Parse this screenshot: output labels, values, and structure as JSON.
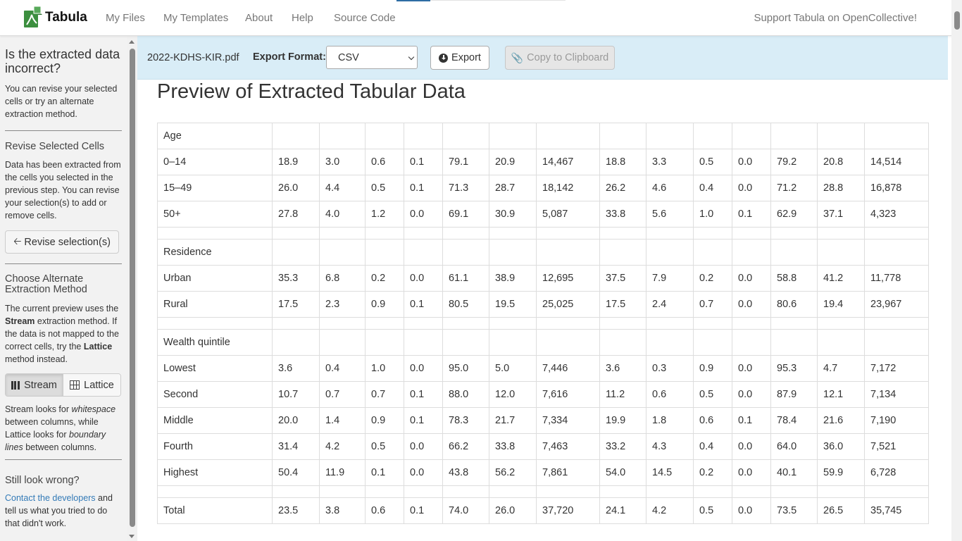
{
  "navbar": {
    "brand": "Tabula",
    "links": [
      "My Files",
      "My Templates",
      "About",
      "Help",
      "Source Code"
    ],
    "support": "Support Tabula on OpenCollective!"
  },
  "sidebar": {
    "heading": "Is the extracted data incorrect?",
    "intro": "You can revise your selected cells or try an alternate extraction method.",
    "revise_heading": "Revise Selected Cells",
    "revise_text": "Data has been extracted from the cells you selected in the previous step. You can revise your selection(s) to add or remove cells.",
    "revise_button": "Revise selection(s)",
    "method_heading": "Choose Alternate Extraction Method",
    "method_text_1": "The current preview uses the",
    "method_current": "Stream",
    "method_text_2": "extraction method. If the data is not mapped to the correct cells, try the",
    "method_alt": "Lattice",
    "method_text_3": "method instead.",
    "stream_button": "Stream",
    "lattice_button": "Lattice",
    "explain_1": "Stream looks for",
    "explain_whitespace": "whitespace",
    "explain_2": "between columns, while Lattice looks for",
    "explain_boundary": "boundary lines",
    "explain_3": "between columns.",
    "wrong_heading": "Still look wrong?",
    "contact_link": "Contact the developers",
    "contact_text": "and tell us what you tried to do that didn't work."
  },
  "toolbar": {
    "filename": "2022-KDHS-KIR.pdf",
    "export_format_label": "Export Format:",
    "export_format_value": "CSV",
    "export_button": "Export",
    "copy_button": "Copy to Clipboard"
  },
  "preview": {
    "title": "Preview of Extracted Tabular Data"
  },
  "table": {
    "rows": [
      [
        "Age",
        "",
        "",
        "",
        "",
        "",
        "",
        "",
        "",
        "",
        "",
        "",
        "",
        "",
        ""
      ],
      [
        "0–14",
        "18.9",
        "3.0",
        "0.6",
        "0.1",
        "79.1",
        "20.9",
        "14,467",
        "18.8",
        "3.3",
        "0.5",
        "0.0",
        "79.2",
        "20.8",
        "14,514"
      ],
      [
        "15–49",
        "26.0",
        "4.4",
        "0.5",
        "0.1",
        "71.3",
        "28.7",
        "18,142",
        "26.2",
        "4.6",
        "0.4",
        "0.0",
        "71.2",
        "28.8",
        "16,878"
      ],
      [
        "50+",
        "27.8",
        "4.0",
        "1.2",
        "0.0",
        "69.1",
        "30.9",
        "5,087",
        "33.8",
        "5.6",
        "1.0",
        "0.1",
        "62.9",
        "37.1",
        "4,323"
      ],
      [],
      [
        "Residence",
        "",
        "",
        "",
        "",
        "",
        "",
        "",
        "",
        "",
        "",
        "",
        "",
        "",
        ""
      ],
      [
        "Urban",
        "35.3",
        "6.8",
        "0.2",
        "0.0",
        "61.1",
        "38.9",
        "12,695",
        "37.5",
        "7.9",
        "0.2",
        "0.0",
        "58.8",
        "41.2",
        "11,778"
      ],
      [
        "Rural",
        "17.5",
        "2.3",
        "0.9",
        "0.1",
        "80.5",
        "19.5",
        "25,025",
        "17.5",
        "2.4",
        "0.7",
        "0.0",
        "80.6",
        "19.4",
        "23,967"
      ],
      [],
      [
        "Wealth quintile",
        "",
        "",
        "",
        "",
        "",
        "",
        "",
        "",
        "",
        "",
        "",
        "",
        "",
        ""
      ],
      [
        "Lowest",
        "3.6",
        "0.4",
        "1.0",
        "0.0",
        "95.0",
        "5.0",
        "7,446",
        "3.6",
        "0.3",
        "0.9",
        "0.0",
        "95.3",
        "4.7",
        "7,172"
      ],
      [
        "Second",
        "10.7",
        "0.7",
        "0.7",
        "0.1",
        "88.0",
        "12.0",
        "7,616",
        "11.2",
        "0.6",
        "0.5",
        "0.0",
        "87.9",
        "12.1",
        "7,134"
      ],
      [
        "Middle",
        "20.0",
        "1.4",
        "0.9",
        "0.1",
        "78.3",
        "21.7",
        "7,334",
        "19.9",
        "1.8",
        "0.6",
        "0.1",
        "78.4",
        "21.6",
        "7,190"
      ],
      [
        "Fourth",
        "31.4",
        "4.2",
        "0.5",
        "0.0",
        "66.2",
        "33.8",
        "7,463",
        "33.2",
        "4.3",
        "0.4",
        "0.0",
        "64.0",
        "36.0",
        "7,521"
      ],
      [
        "Highest",
        "50.4",
        "11.9",
        "0.1",
        "0.0",
        "43.8",
        "56.2",
        "7,861",
        "54.0",
        "14.5",
        "0.2",
        "0.0",
        "40.1",
        "59.9",
        "6,728"
      ],
      [],
      [
        "Total",
        "23.5",
        "3.8",
        "0.6",
        "0.1",
        "74.0",
        "26.0",
        "37,720",
        "24.1",
        "4.2",
        "0.5",
        "0.0",
        "73.5",
        "26.5",
        "35,745"
      ]
    ]
  }
}
